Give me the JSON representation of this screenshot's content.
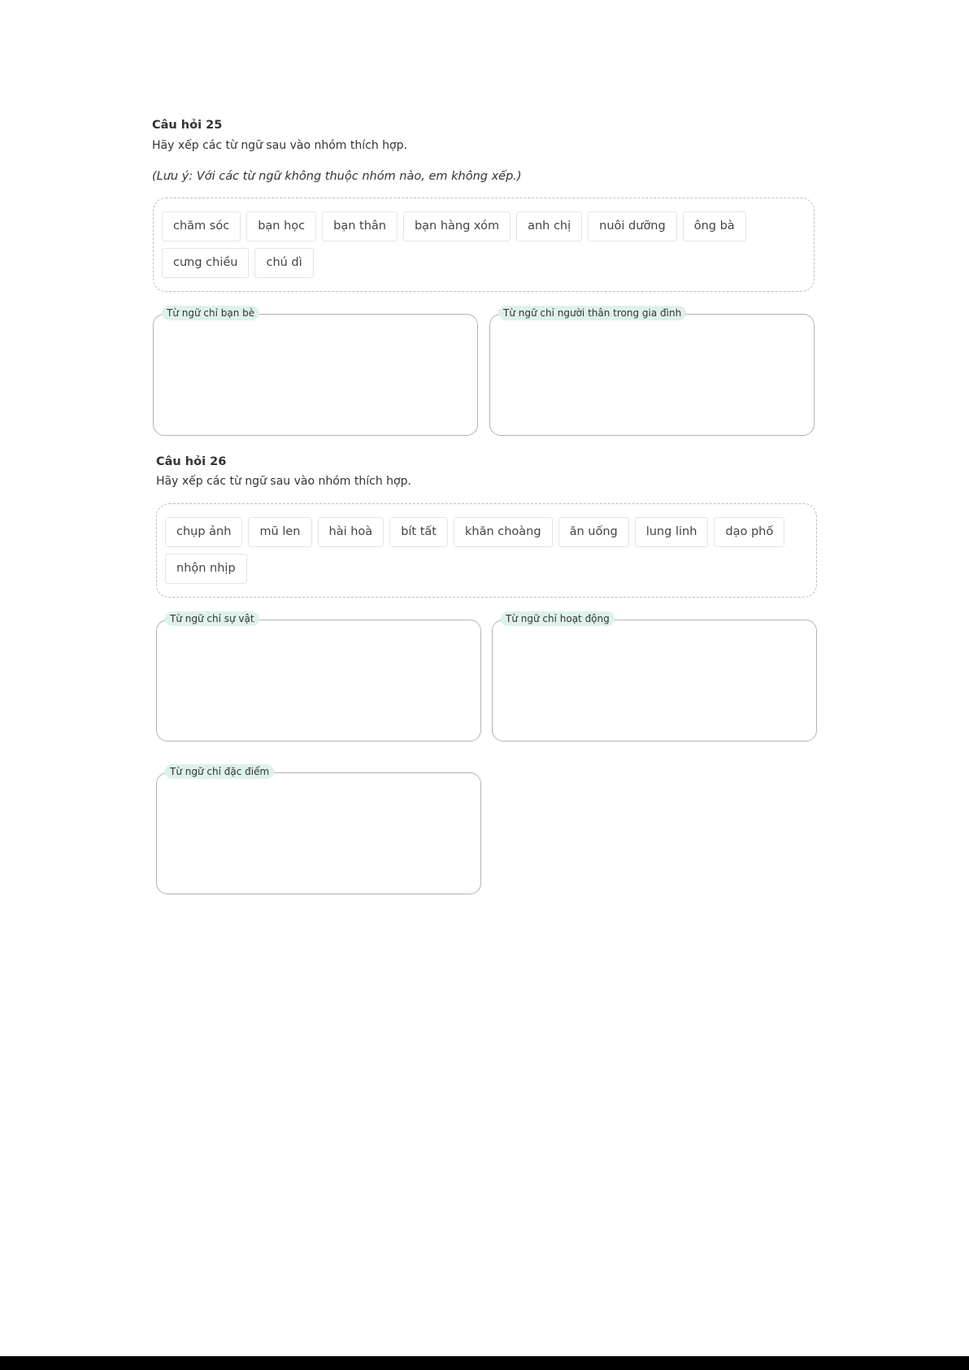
{
  "q25": {
    "title": "Câu hỏi 25",
    "instruction": "Hãy xếp các từ ngữ sau vào nhóm thích hợp.",
    "note": "(Lưu ý: Với các từ ngữ không thuộc nhóm nào, em không xếp.)",
    "words": [
      "chăm sóc",
      "bạn học",
      "bạn thân",
      "bạn hàng xóm",
      "anh chị",
      "nuôi dưỡng",
      "ông bà",
      "cưng chiều",
      "chú dì"
    ],
    "groups": [
      "Từ ngữ chỉ bạn bè",
      "Từ ngữ chỉ người thân trong gia đình"
    ]
  },
  "q26": {
    "title": "Câu hỏi 26",
    "instruction": "Hãy xếp các từ ngữ sau vào nhóm thích hợp.",
    "words": [
      "chụp ảnh",
      "mũ len",
      "hài hoà",
      "bít tất",
      "khăn choàng",
      "ăn uống",
      "lung linh",
      "dạo phố",
      "nhộn nhịp"
    ],
    "groups": [
      "Từ ngữ chỉ sự vật",
      "Từ ngữ chỉ hoạt động",
      "Từ ngữ chỉ đặc điểm"
    ]
  }
}
